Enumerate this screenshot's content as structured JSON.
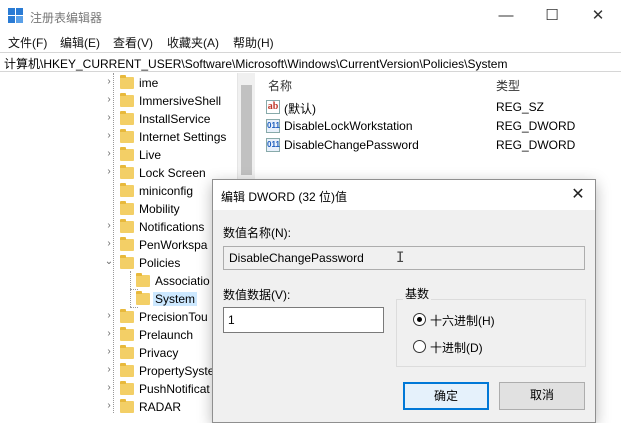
{
  "window": {
    "title": "注册表编辑器",
    "minimize": "—",
    "maximize": "☐",
    "close": "✕"
  },
  "menu": [
    "文件(F)",
    "编辑(E)",
    "查看(V)",
    "收藏夹(A)",
    "帮助(H)"
  ],
  "address": "计算机\\HKEY_CURRENT_USER\\Software\\Microsoft\\Windows\\CurrentVersion\\Policies\\System",
  "tree": [
    {
      "label": "ime",
      "chevron": "›"
    },
    {
      "label": "ImmersiveShell",
      "chevron": "›"
    },
    {
      "label": "InstallService",
      "chevron": "›"
    },
    {
      "label": "Internet Settings",
      "chevron": "›"
    },
    {
      "label": "Live",
      "chevron": "›"
    },
    {
      "label": "Lock Screen",
      "chevron": "›"
    },
    {
      "label": "miniconfig",
      "chevron": ""
    },
    {
      "label": "Mobility",
      "chevron": ""
    },
    {
      "label": "Notifications",
      "chevron": "›"
    },
    {
      "label": "PenWorkspa",
      "chevron": "›"
    },
    {
      "label": "Policies",
      "chevron": "⌄"
    },
    {
      "label": "Associatio",
      "chevron": ""
    },
    {
      "label": "System",
      "chevron": ""
    },
    {
      "label": "PrecisionTou",
      "chevron": "›"
    },
    {
      "label": "Prelaunch",
      "chevron": "›"
    },
    {
      "label": "Privacy",
      "chevron": "›"
    },
    {
      "label": "PropertySyste",
      "chevron": "›"
    },
    {
      "label": "PushNotificat",
      "chevron": "›"
    },
    {
      "label": "RADAR",
      "chevron": "›"
    }
  ],
  "list": {
    "col_name": "名称",
    "col_type": "类型",
    "rows": [
      {
        "icon": "ab",
        "name": "(默认)",
        "type": "REG_SZ"
      },
      {
        "icon": "011",
        "name": "DisableLockWorkstation",
        "type": "REG_DWORD"
      },
      {
        "icon": "011",
        "name": "DisableChangePassword",
        "type": "REG_DWORD"
      }
    ]
  },
  "dialog": {
    "title": "编辑 DWORD (32 位)值",
    "close": "✕",
    "name_label": "数值名称(N):",
    "name_value": "DisableChangePassword",
    "data_label": "数值数据(V):",
    "data_value": "1",
    "base_label": "基数",
    "radio_hex": "十六进制(H)",
    "radio_dec": "十进制(D)",
    "ok": "确定",
    "cancel": "取消"
  },
  "colors": {
    "accent": "#0078d7",
    "selection": "#cce8ff",
    "folder": "#f3cf66"
  }
}
